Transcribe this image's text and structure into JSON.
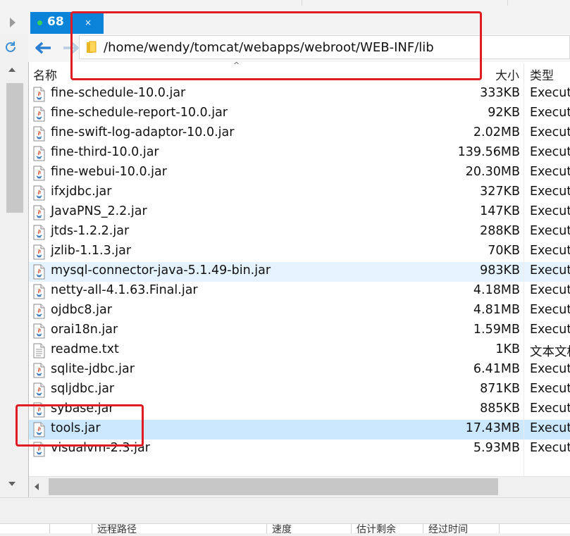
{
  "tabs": [
    {
      "label": "68"
    }
  ],
  "address": {
    "path": "/home/wendy/tomcat/webapps/webroot/WEB-INF/lib"
  },
  "columns": {
    "name": "名称",
    "size": "大小",
    "type": "类型"
  },
  "files": [
    {
      "name": "fine-schedule-10.0.jar",
      "size": "333KB",
      "type": "Executa",
      "icon": "jar-file-icon"
    },
    {
      "name": "fine-schedule-report-10.0.jar",
      "size": "92KB",
      "type": "Executa",
      "icon": "jar-file-icon"
    },
    {
      "name": "fine-swift-log-adaptor-10.0.jar",
      "size": "2.02MB",
      "type": "Executa",
      "icon": "jar-file-icon"
    },
    {
      "name": "fine-third-10.0.jar",
      "size": "139.56MB",
      "type": "Executa",
      "icon": "jar-file-icon"
    },
    {
      "name": "fine-webui-10.0.jar",
      "size": "20.30MB",
      "type": "Executa",
      "icon": "jar-file-icon"
    },
    {
      "name": "ifxjdbc.jar",
      "size": "327KB",
      "type": "Executa",
      "icon": "jar-file-icon"
    },
    {
      "name": "JavaPNS_2.2.jar",
      "size": "147KB",
      "type": "Executa",
      "icon": "jar-file-icon"
    },
    {
      "name": "jtds-1.2.2.jar",
      "size": "288KB",
      "type": "Executa",
      "icon": "jar-file-icon"
    },
    {
      "name": "jzlib-1.1.3.jar",
      "size": "70KB",
      "type": "Executa",
      "icon": "jar-file-icon"
    },
    {
      "name": "mysql-connector-java-5.1.49-bin.jar",
      "size": "983KB",
      "type": "Executa",
      "icon": "jar-file-icon"
    },
    {
      "name": "netty-all-4.1.63.Final.jar",
      "size": "4.18MB",
      "type": "Executa",
      "icon": "jar-file-icon"
    },
    {
      "name": "ojdbc8.jar",
      "size": "4.81MB",
      "type": "Executa",
      "icon": "jar-file-icon"
    },
    {
      "name": "orai18n.jar",
      "size": "1.59MB",
      "type": "Executa",
      "icon": "jar-file-icon"
    },
    {
      "name": "readme.txt",
      "size": "1KB",
      "type": "文本文档",
      "icon": "text-file-icon"
    },
    {
      "name": "sqlite-jdbc.jar",
      "size": "6.41MB",
      "type": "Executa",
      "icon": "jar-file-icon"
    },
    {
      "name": "sqljdbc.jar",
      "size": "871KB",
      "type": "Executa",
      "icon": "jar-file-icon"
    },
    {
      "name": "sybase.jar",
      "size": "885KB",
      "type": "Executa",
      "icon": "jar-file-icon"
    },
    {
      "name": "tools.jar",
      "size": "17.43MB",
      "type": "Executa",
      "icon": "jar-file-icon"
    },
    {
      "name": "visualvm-2.3.jar",
      "size": "5.93MB",
      "type": "Executa",
      "icon": "jar-file-icon"
    }
  ],
  "transfer_columns": [
    "远程路径",
    "速度",
    "估计剩余",
    "经过时间"
  ],
  "colors": {
    "tab_active": "#0a84d8",
    "row_selected": "#cce8ff",
    "row_hover": "#e5f3ff",
    "highlight": "#e01b24"
  }
}
